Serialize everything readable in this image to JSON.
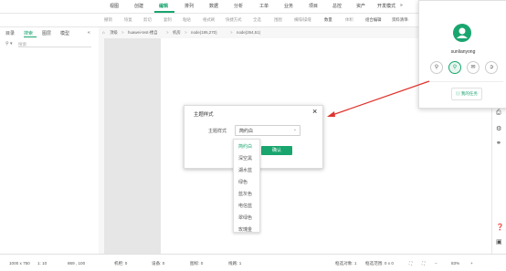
{
  "topmenu": {
    "items": [
      "视图",
      "创建",
      "编辑",
      "排列",
      "数据",
      "分析",
      "工单",
      "业务",
      "项目",
      "总控",
      "资产",
      "开发模式"
    ],
    "more": "»"
  },
  "notifications": {
    "count": "139"
  },
  "toolbar": {
    "items": [
      "撤销",
      "恢复",
      "剪切",
      "复制",
      "粘贴",
      "格式刷",
      "快捷方式",
      "全选",
      "围图",
      "横隔/操缝",
      "数量",
      "体积",
      "组合编辑",
      "资料清单"
    ],
    "more": "»"
  },
  "left_panel": {
    "tabs": [
      "目录",
      "搜索",
      "图层",
      "模型"
    ],
    "collapse": "«",
    "search_placeholder": "搜索"
  },
  "breadcrumb": [
    "顶级",
    "huawei-test-楼自",
    "机房",
    "node(195,270)",
    "node(264,51)"
  ],
  "dialog": {
    "title": "主题样式",
    "label": "主题样式",
    "selected": "简约白",
    "confirm": "确认",
    "close": "×"
  },
  "dropdown": {
    "options": [
      "简约白",
      "深空黑",
      "湖水蓝",
      "绿色",
      "蓝灰色",
      "电信蓝",
      "翠绿色",
      "玫瑰金"
    ]
  },
  "popover": {
    "username": "sunlianyong",
    "my_tasks": "我的任务"
  },
  "statusbar": {
    "canvas_size": "1000 x 750",
    "ratio": "1: 10",
    "coords": "869 , 100",
    "cabinets": "机柜: 0",
    "devices": "设备: 0",
    "graphics": "图标: 0",
    "lines": "线路: 1",
    "box_count": "框选对象: 1",
    "box_range": "框选范围: 0 x 0",
    "zoom": "83%"
  },
  "colors": {
    "accent": "#19a56e",
    "arrow": "#e0342d"
  }
}
